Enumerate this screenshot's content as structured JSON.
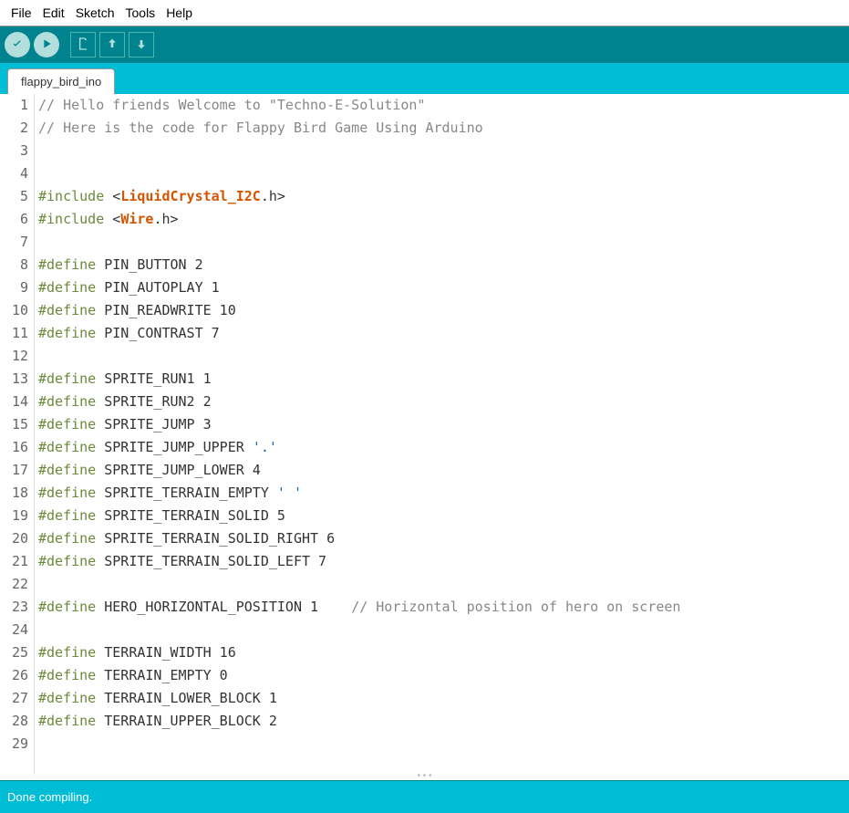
{
  "menu": {
    "items": [
      "File",
      "Edit",
      "Sketch",
      "Tools",
      "Help"
    ]
  },
  "toolbar": {
    "verify": "verify-icon",
    "upload": "upload-icon",
    "new": "new-icon",
    "open": "open-icon",
    "save": "save-icon"
  },
  "tab": {
    "name": "flappy_bird_ino"
  },
  "status": {
    "message": "Done compiling."
  },
  "code": {
    "lines": [
      {
        "n": 1,
        "tokens": [
          {
            "cls": "tk-comment",
            "t": "// Hello friends Welcome to \"Techno-E-Solution\""
          }
        ]
      },
      {
        "n": 2,
        "tokens": [
          {
            "cls": "tk-comment",
            "t": "// Here is the code for Flappy Bird Game Using Arduino"
          }
        ]
      },
      {
        "n": 3,
        "tokens": []
      },
      {
        "n": 4,
        "tokens": []
      },
      {
        "n": 5,
        "tokens": [
          {
            "cls": "tk-pre",
            "t": "#include "
          },
          {
            "cls": "tk-plain",
            "t": "<"
          },
          {
            "cls": "tk-lib",
            "t": "LiquidCrystal_I2C"
          },
          {
            "cls": "tk-ext",
            "t": ".h"
          },
          {
            "cls": "tk-plain",
            "t": ">"
          }
        ]
      },
      {
        "n": 6,
        "tokens": [
          {
            "cls": "tk-pre",
            "t": "#include "
          },
          {
            "cls": "tk-plain",
            "t": "<"
          },
          {
            "cls": "tk-lib",
            "t": "Wire"
          },
          {
            "cls": "tk-ext",
            "t": ".h"
          },
          {
            "cls": "tk-plain",
            "t": ">"
          }
        ]
      },
      {
        "n": 7,
        "tokens": []
      },
      {
        "n": 8,
        "tokens": [
          {
            "cls": "tk-pre",
            "t": "#define"
          },
          {
            "cls": "tk-plain",
            "t": " PIN_BUTTON 2"
          }
        ]
      },
      {
        "n": 9,
        "tokens": [
          {
            "cls": "tk-pre",
            "t": "#define"
          },
          {
            "cls": "tk-plain",
            "t": " PIN_AUTOPLAY 1"
          }
        ]
      },
      {
        "n": 10,
        "tokens": [
          {
            "cls": "tk-pre",
            "t": "#define"
          },
          {
            "cls": "tk-plain",
            "t": " PIN_READWRITE 10"
          }
        ]
      },
      {
        "n": 11,
        "tokens": [
          {
            "cls": "tk-pre",
            "t": "#define"
          },
          {
            "cls": "tk-plain",
            "t": " PIN_CONTRAST 7"
          }
        ]
      },
      {
        "n": 12,
        "tokens": []
      },
      {
        "n": 13,
        "tokens": [
          {
            "cls": "tk-pre",
            "t": "#define"
          },
          {
            "cls": "tk-plain",
            "t": " SPRITE_RUN1 1"
          }
        ]
      },
      {
        "n": 14,
        "tokens": [
          {
            "cls": "tk-pre",
            "t": "#define"
          },
          {
            "cls": "tk-plain",
            "t": " SPRITE_RUN2 2"
          }
        ]
      },
      {
        "n": 15,
        "tokens": [
          {
            "cls": "tk-pre",
            "t": "#define"
          },
          {
            "cls": "tk-plain",
            "t": " SPRITE_JUMP 3"
          }
        ]
      },
      {
        "n": 16,
        "tokens": [
          {
            "cls": "tk-pre",
            "t": "#define"
          },
          {
            "cls": "tk-plain",
            "t": " SPRITE_JUMP_UPPER "
          },
          {
            "cls": "tk-str",
            "t": "'.'"
          }
        ]
      },
      {
        "n": 17,
        "tokens": [
          {
            "cls": "tk-pre",
            "t": "#define"
          },
          {
            "cls": "tk-plain",
            "t": " SPRITE_JUMP_LOWER 4"
          }
        ]
      },
      {
        "n": 18,
        "tokens": [
          {
            "cls": "tk-pre",
            "t": "#define"
          },
          {
            "cls": "tk-plain",
            "t": " SPRITE_TERRAIN_EMPTY "
          },
          {
            "cls": "tk-str",
            "t": "' '"
          }
        ]
      },
      {
        "n": 19,
        "tokens": [
          {
            "cls": "tk-pre",
            "t": "#define"
          },
          {
            "cls": "tk-plain",
            "t": " SPRITE_TERRAIN_SOLID 5"
          }
        ]
      },
      {
        "n": 20,
        "tokens": [
          {
            "cls": "tk-pre",
            "t": "#define"
          },
          {
            "cls": "tk-plain",
            "t": " SPRITE_TERRAIN_SOLID_RIGHT 6"
          }
        ]
      },
      {
        "n": 21,
        "tokens": [
          {
            "cls": "tk-pre",
            "t": "#define"
          },
          {
            "cls": "tk-plain",
            "t": " SPRITE_TERRAIN_SOLID_LEFT 7"
          }
        ]
      },
      {
        "n": 22,
        "tokens": []
      },
      {
        "n": 23,
        "tokens": [
          {
            "cls": "tk-pre",
            "t": "#define"
          },
          {
            "cls": "tk-plain",
            "t": " HERO_HORIZONTAL_POSITION 1    "
          },
          {
            "cls": "tk-comment",
            "t": "// Horizontal position of hero on screen"
          }
        ]
      },
      {
        "n": 24,
        "tokens": []
      },
      {
        "n": 25,
        "tokens": [
          {
            "cls": "tk-pre",
            "t": "#define"
          },
          {
            "cls": "tk-plain",
            "t": " TERRAIN_WIDTH 16"
          }
        ]
      },
      {
        "n": 26,
        "tokens": [
          {
            "cls": "tk-pre",
            "t": "#define"
          },
          {
            "cls": "tk-plain",
            "t": " TERRAIN_EMPTY 0"
          }
        ]
      },
      {
        "n": 27,
        "tokens": [
          {
            "cls": "tk-pre",
            "t": "#define"
          },
          {
            "cls": "tk-plain",
            "t": " TERRAIN_LOWER_BLOCK 1"
          }
        ]
      },
      {
        "n": 28,
        "tokens": [
          {
            "cls": "tk-pre",
            "t": "#define"
          },
          {
            "cls": "tk-plain",
            "t": " TERRAIN_UPPER_BLOCK 2"
          }
        ]
      },
      {
        "n": 29,
        "tokens": []
      }
    ]
  }
}
